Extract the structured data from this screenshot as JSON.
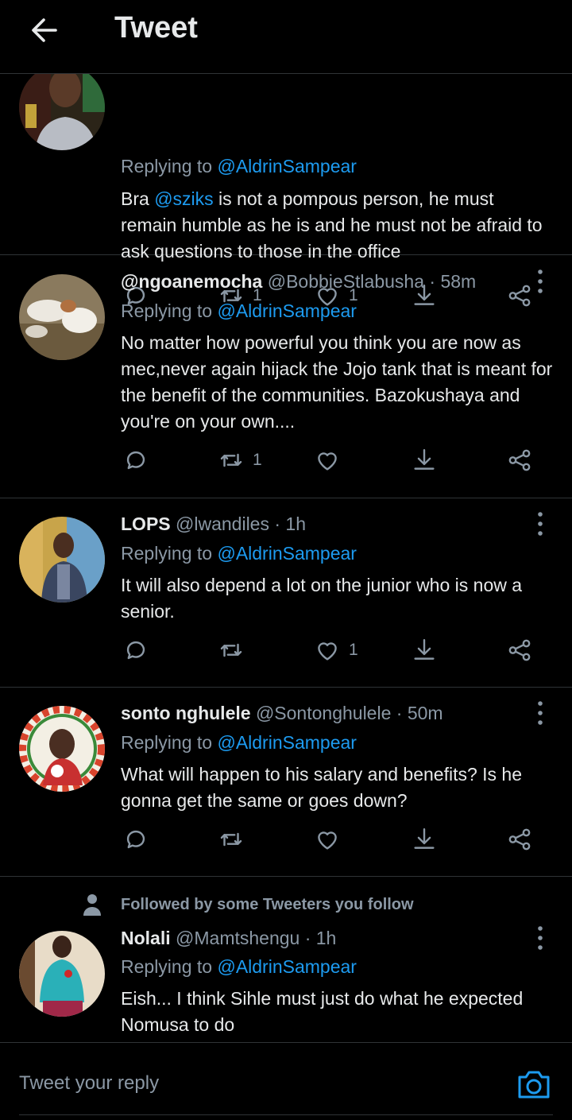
{
  "header": {
    "title": "Tweet"
  },
  "tweets": [
    {
      "reply_label": "Replying to",
      "reply_handle": "@AldrinSampear",
      "text_a": "Bra ",
      "mention": "@sziks",
      "text_b": " is not a pompous person, he must remain humble as he is and he must not be afraid to ask questions to those in the office",
      "retweets": "1",
      "likes": "1"
    },
    {
      "name": "@ngoanemocha",
      "handle": "@BobbieStlabusha",
      "time": "· 58m",
      "reply_label": "Replying to",
      "reply_handle": "@AldrinSampear",
      "text": "No matter how powerful you think you are now as mec,never again hijack the Jojo tank that is meant for the benefit of the communities. Bazokushaya and you're on your own....",
      "retweets": "1",
      "likes": ""
    },
    {
      "name": "LOPS",
      "handle": "@lwandiles",
      "time": "· 1h",
      "reply_label": "Replying to",
      "reply_handle": "@AldrinSampear",
      "text": "It will also depend a lot on the junior who is now a senior.",
      "retweets": "",
      "likes": "1"
    },
    {
      "name": "sonto nghulele",
      "handle": "@Sontonghulele",
      "time": "· 50m",
      "reply_label": "Replying to",
      "reply_handle": "@AldrinSampear",
      "text": "What will happen to his salary and benefits? Is he gonna get the same or goes down?",
      "retweets": "",
      "likes": ""
    },
    {
      "followed_note": "Followed by some Tweeters you follow",
      "name": "Nolali",
      "handle": "@Mamtshengu",
      "time": "· 1h",
      "reply_label": "Replying to",
      "reply_handle": "@AldrinSampear",
      "text": "Eish... I think Sihle must just do what he expected Nomusa to do"
    }
  ],
  "composer": {
    "placeholder": "Tweet your reply"
  },
  "colors": {
    "background": "#000000",
    "accent": "#1d9bf0",
    "muted": "#8b98a5",
    "text": "#e7e9ea",
    "divider": "#2f3336"
  },
  "icons": [
    "back-arrow-icon",
    "more-icon",
    "reply-icon",
    "retweet-icon",
    "like-icon",
    "bookmark-icon",
    "share-icon",
    "person-icon",
    "camera-icon"
  ]
}
